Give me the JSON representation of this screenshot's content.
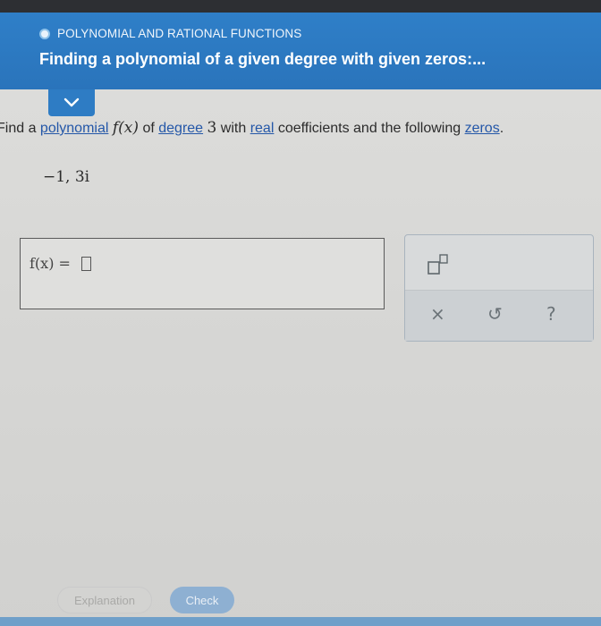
{
  "header": {
    "topic": "POLYNOMIAL AND RATIONAL FUNCTIONS",
    "title": "Finding a polynomial of a given degree with given zeros:..."
  },
  "question": {
    "part1": "Find a ",
    "link_polynomial": "polynomial",
    "math_fx": "f(x)",
    "part2": " of ",
    "link_degree": "degree",
    "degree_value": "3",
    "part3": " with ",
    "link_real": "real",
    "part4": " coefficients and the following ",
    "link_zeros": "zeros",
    "period": "."
  },
  "zeros_given": "−1, 3i",
  "answer": {
    "label": "f(x) =",
    "value": ""
  },
  "tools": {
    "power_icon": "superscript-template-icon",
    "clear_symbol": "×",
    "undo_symbol": "↺",
    "help_symbol": "?"
  },
  "buttons": {
    "explanation": "Explanation",
    "check": "Check"
  },
  "colors": {
    "header_bg": "#2f7fc8",
    "link": "#2457a8",
    "check_button": "#8eb0d2"
  }
}
